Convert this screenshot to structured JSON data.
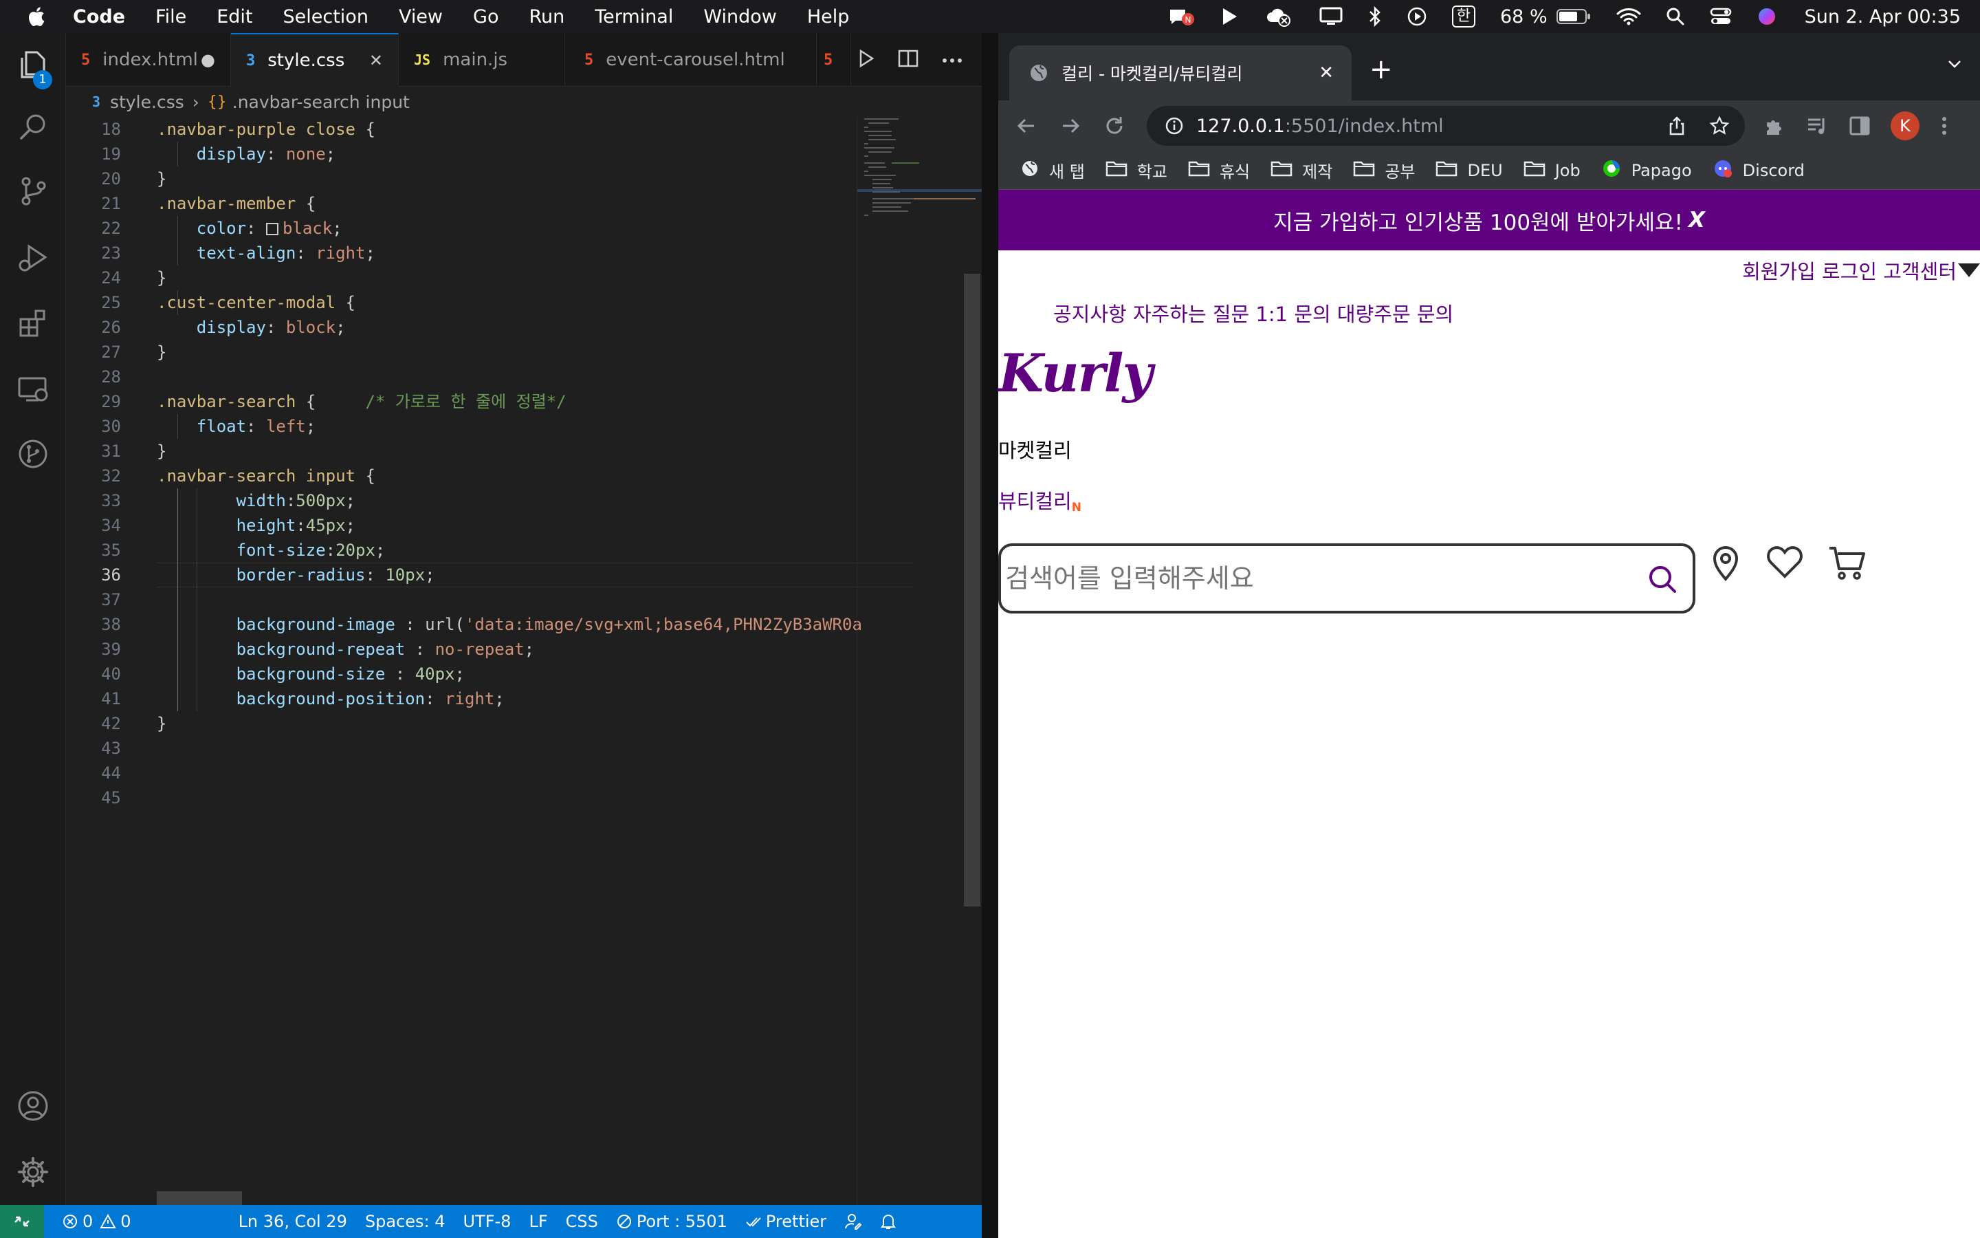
{
  "menubar": {
    "app": "Code",
    "items": [
      "File",
      "Edit",
      "Selection",
      "View",
      "Go",
      "Run",
      "Terminal",
      "Window",
      "Help"
    ],
    "input_method": "한",
    "battery": "68 %",
    "clock": "Sun 2. Apr  00:35"
  },
  "vscode": {
    "explorer_badge": "1",
    "tabs": [
      {
        "label": "index.html",
        "icon": "html5-icon",
        "marker": "●"
      },
      {
        "label": "style.css",
        "icon": "css3-icon",
        "marker": "✕"
      },
      {
        "label": "main.js",
        "icon": "js-icon",
        "marker": ""
      },
      {
        "label": "event-carousel.html",
        "icon": "html5-icon",
        "marker": ""
      }
    ],
    "breadcrumb": {
      "file": "style.css",
      "symbol": ".navbar-search input"
    },
    "lines": [
      {
        "n": "18",
        "text": ".navbar-purple close {"
      },
      {
        "n": "19",
        "text": "    display: none;"
      },
      {
        "n": "20",
        "text": "}"
      },
      {
        "n": "21",
        "text": ".navbar-member {"
      },
      {
        "n": "22",
        "text": "    color: black;"
      },
      {
        "n": "23",
        "text": "    text-align: right;"
      },
      {
        "n": "24",
        "text": "}"
      },
      {
        "n": "25",
        "text": ".cust-center-modal {"
      },
      {
        "n": "26",
        "text": "    display: block;"
      },
      {
        "n": "27",
        "text": "}"
      },
      {
        "n": "28",
        "text": ""
      },
      {
        "n": "29",
        "text": ".navbar-search {     /* 가로로 한 줄에 정렬*/"
      },
      {
        "n": "30",
        "text": "    float: left;"
      },
      {
        "n": "31",
        "text": "}"
      },
      {
        "n": "32",
        "text": ".navbar-search input {"
      },
      {
        "n": "33",
        "text": "        width:500px;"
      },
      {
        "n": "34",
        "text": "        height:45px;"
      },
      {
        "n": "35",
        "text": "        font-size:20px;"
      },
      {
        "n": "36",
        "text": "        border-radius: 10px;"
      },
      {
        "n": "37",
        "text": ""
      },
      {
        "n": "38",
        "text": "        background-image : url('data:image/svg+xml;base64,PHN2ZyB3aWR0a"
      },
      {
        "n": "39",
        "text": "        background-repeat : no-repeat;"
      },
      {
        "n": "40",
        "text": "        background-size : 40px;"
      },
      {
        "n": "41",
        "text": "        background-position: right;"
      },
      {
        "n": "42",
        "text": "}"
      },
      {
        "n": "43",
        "text": ""
      },
      {
        "n": "44",
        "text": ""
      },
      {
        "n": "45",
        "text": ""
      }
    ],
    "current_line": "36",
    "status": {
      "errors": "0",
      "warnings": "0",
      "position": "Ln 36, Col 29",
      "spaces": "Spaces: 4",
      "encoding": "UTF-8",
      "eol": "LF",
      "language": "CSS",
      "port": "Port : 5501",
      "formatter": "Prettier"
    }
  },
  "chrome": {
    "tab_title": "컬리 - 마켓컬리/뷰티컬리",
    "url_host": "127.0.0.1",
    "url_path": ":5501/index.html",
    "avatar": "K",
    "bookmarks": [
      {
        "label": "새 탭",
        "icon": "globe-icon"
      },
      {
        "label": "학교",
        "icon": "folder-icon"
      },
      {
        "label": "휴식",
        "icon": "folder-icon"
      },
      {
        "label": "제작",
        "icon": "folder-icon"
      },
      {
        "label": "공부",
        "icon": "folder-icon"
      },
      {
        "label": "DEU",
        "icon": "folder-icon"
      },
      {
        "label": "Job",
        "icon": "folder-icon"
      },
      {
        "label": "Papago",
        "icon": "papago-icon"
      },
      {
        "label": "Discord",
        "icon": "discord-icon"
      }
    ]
  },
  "page": {
    "promo_text": "지금 가입하고 인기상품 100원에 받아가세요!",
    "promo_close": "X",
    "member_links": "회원가입 로그인 고객센터",
    "cust_links": "공지사항 자주하는 질문 1:1 문의 대량주문 문의",
    "logo": "Kurly",
    "market_link": "마켓컬리",
    "beauty_link": "뷰티컬리",
    "beauty_badge": "N",
    "search_placeholder": "검색어를 입력해주세요"
  },
  "colors": {
    "kurly_purple": "#5f0080",
    "vscode_blue": "#0078d4",
    "chrome_dark": "#35363a"
  }
}
